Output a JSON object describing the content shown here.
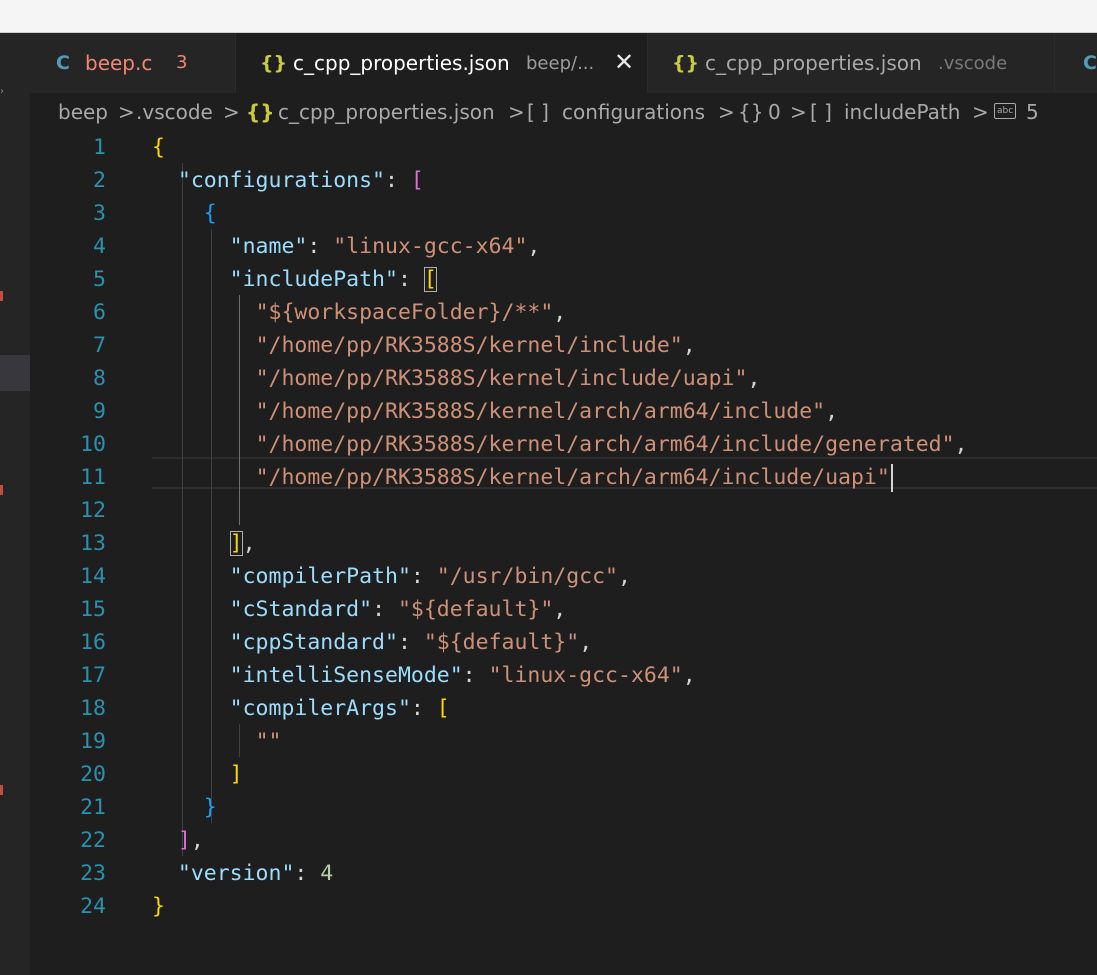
{
  "tabs": [
    {
      "icon": "C",
      "name": "beep.c",
      "badge": "3"
    },
    {
      "icon": "{}",
      "name": "c_cpp_properties.json",
      "desc": "beep/...",
      "close": "✕"
    },
    {
      "icon": "{}",
      "name": "c_cpp_properties.json",
      "desc": ".vscode"
    },
    {
      "icon": "C"
    }
  ],
  "breadcrumb": {
    "parts": [
      "beep",
      ".vscode",
      "c_cpp_properties.json",
      "configurations",
      "0",
      "includePath",
      "5"
    ],
    "separators": [
      ">",
      ">",
      ">",
      ">",
      ">",
      ">"
    ],
    "icons": {
      "json_icon": "{}",
      "array_icon": "[ ]",
      "object_icon": "{}",
      "string_icon": "abc"
    }
  },
  "line_numbers": [
    "1",
    "2",
    "3",
    "4",
    "5",
    "6",
    "7",
    "8",
    "9",
    "10",
    "11",
    "12",
    "13",
    "14",
    "15",
    "16",
    "17",
    "18",
    "19",
    "20",
    "21",
    "22",
    "23",
    "24"
  ],
  "code": {
    "l1": "{",
    "configurations_key": "\"configurations\"",
    "l3": "{",
    "name_key": "\"name\"",
    "name_val": "\"linux-gcc-x64\"",
    "includePath_key": "\"includePath\"",
    "include_items": [
      "\"${workspaceFolder}/**\"",
      "\"/home/pp/RK3588S/kernel/include\"",
      "\"/home/pp/RK3588S/kernel/include/uapi\"",
      "\"/home/pp/RK3588S/kernel/arch/arm64/include\"",
      "\"/home/pp/RK3588S/kernel/arch/arm64/include/generated\"",
      "\"/home/pp/RK3588S/kernel/arch/arm64/include/uapi\""
    ],
    "compilerPath_key": "\"compilerPath\"",
    "compilerPath_val": "\"/usr/bin/gcc\"",
    "cStandard_key": "\"cStandard\"",
    "cStandard_val": "\"${default}\"",
    "cppStandard_key": "\"cppStandard\"",
    "cppStandard_val": "\"${default}\"",
    "intelliSenseMode_key": "\"intelliSenseMode\"",
    "intelliSenseMode_val": "\"linux-gcc-x64\"",
    "compilerArgs_key": "\"compilerArgs\"",
    "compilerArgs_item": "\"\"",
    "version_key": "\"version\"",
    "version_val": "4"
  },
  "colors": {
    "key": "#9cdcfe",
    "string": "#ce9178",
    "number": "#b5cea8",
    "bracket1": "#ffd700",
    "bracket2": "#da70d6",
    "bracket3": "#179fff",
    "line_number": "#2b91af",
    "error": "#f48771"
  }
}
